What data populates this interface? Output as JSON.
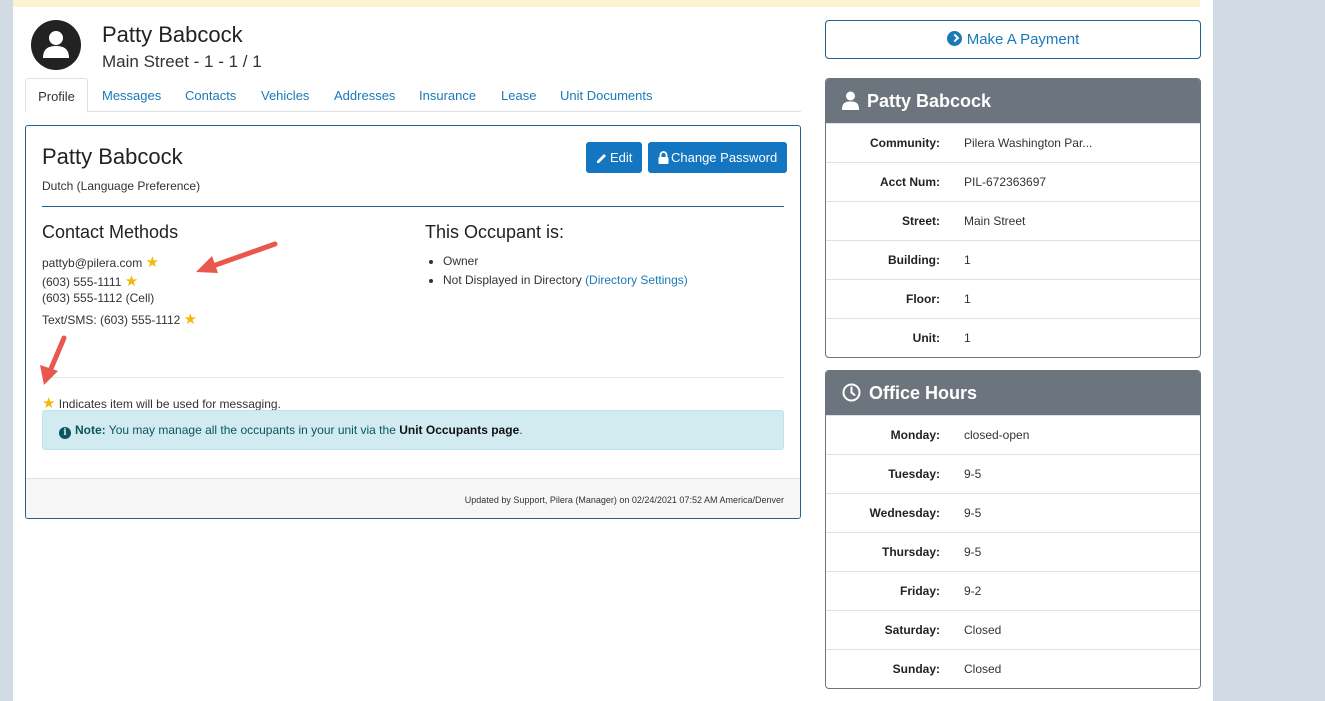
{
  "header": {
    "name": "Patty Babcock",
    "unit_line": "Main Street - 1 - 1 / 1"
  },
  "tabs": [
    {
      "label": "Profile",
      "active": true
    },
    {
      "label": "Messages"
    },
    {
      "label": "Contacts"
    },
    {
      "label": "Vehicles"
    },
    {
      "label": "Addresses"
    },
    {
      "label": "Insurance"
    },
    {
      "label": "Lease"
    },
    {
      "label": "Unit Documents"
    }
  ],
  "profile": {
    "name": "Patty Babcock",
    "language": "Dutch (Language Preference)",
    "edit_label": "Edit",
    "change_password_label": "Change Password",
    "contact_title": "Contact Methods",
    "contacts": [
      {
        "text": "pattyb@pilera.com",
        "starred": true
      },
      {
        "text": "(603) 555-1111",
        "starred": true
      },
      {
        "text": "(603) 555-1112 (Cell)",
        "starred": false
      },
      {
        "text": "Text/SMS: (603) 555-1112",
        "starred": true
      }
    ],
    "occupant_title": "This Occupant is:",
    "occupant_items": [
      "Owner",
      "Not Displayed in Directory"
    ],
    "directory_link": "(Directory Settings)",
    "legend": "Indicates item will be used for messaging.",
    "note_label": "Note:",
    "note_text": "You may manage all the occupants in your unit via the",
    "note_link": "Unit Occupants page",
    "note_end": ".",
    "footer": "Updated by Support, Pilera (Manager) on 02/24/2021 07:52 AM America/Denver"
  },
  "sidebar": {
    "pay_label": "Make A Payment",
    "account_title": "Patty Babcock",
    "account_rows": [
      {
        "key": "Community:",
        "value": "Pilera Washington Par..."
      },
      {
        "key": "Acct Num:",
        "value": "PIL-672363697"
      },
      {
        "key": "Street:",
        "value": "Main Street"
      },
      {
        "key": "Building:",
        "value": "1"
      },
      {
        "key": "Floor:",
        "value": "1"
      },
      {
        "key": "Unit:",
        "value": "1"
      }
    ],
    "hours_title": "Office Hours",
    "hours_rows": [
      {
        "key": "Monday:",
        "value": "closed-open"
      },
      {
        "key": "Tuesday:",
        "value": "9-5"
      },
      {
        "key": "Wednesday:",
        "value": "9-5"
      },
      {
        "key": "Thursday:",
        "value": "9-5"
      },
      {
        "key": "Friday:",
        "value": "9-2"
      },
      {
        "key": "Saturday:",
        "value": "Closed"
      },
      {
        "key": "Sunday:",
        "value": "Closed"
      }
    ]
  },
  "colors": {
    "accent": "#1475c0",
    "link": "#1a7ab8",
    "panel_header": "#6c757d",
    "star": "#f5b70a",
    "annotation_arrow": "#e8584c"
  }
}
